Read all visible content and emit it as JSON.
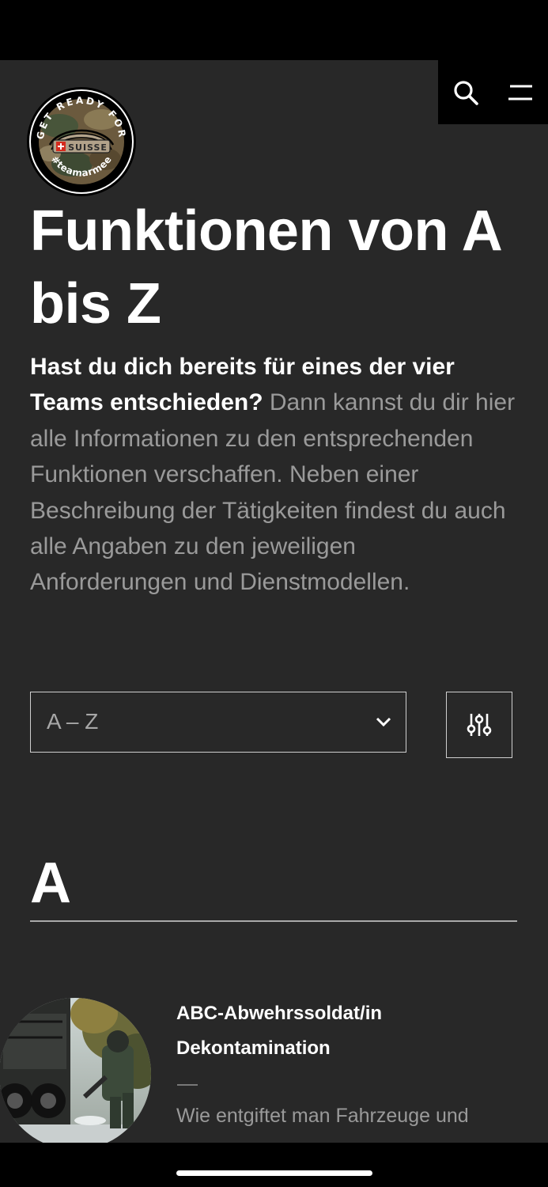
{
  "header": {
    "logo_text_top": "GET READY FOR",
    "logo_text_middle": "SUISSE",
    "logo_text_bottom": "#teamarmee",
    "search_icon": "search-icon",
    "menu_icon": "menu-icon"
  },
  "main": {
    "title_line1": "Funktionen von A",
    "title_line2": "bis Z",
    "intro_bold": "Hast du dich bereits für eines der vier Teams entschieden?",
    "intro_text": " Dann kannst du dir hier alle Informationen zu den entsprechenden Funktionen verschaffen. Neben einer Beschreibung der Tätigkeiten findest du auch alle Angaben zu den jeweiligen Anforderungen und Dienstmodellen.",
    "sort_select": {
      "value": "A – Z",
      "icon": "chevron-down-icon"
    },
    "filter_icon": "sliders-icon",
    "section_letter": "A",
    "items": [
      {
        "title_line1": "ABC-Abwehrssoldat/in",
        "title_line2": "Dekontamination",
        "teaser": "Wie entgiftet man Fahrzeuge und"
      }
    ]
  }
}
